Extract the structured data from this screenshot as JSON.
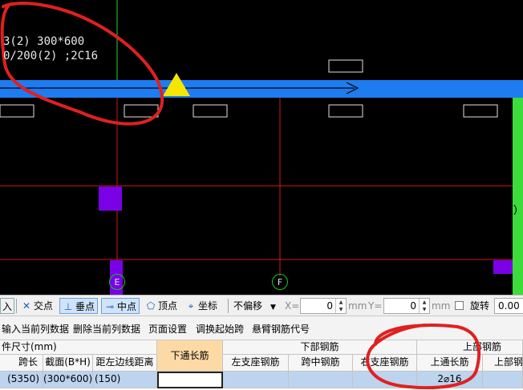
{
  "canvas": {
    "beam_label_line1": "3(2) 300*600",
    "beam_label_line2": "0/200(2) ;2C16",
    "axis_labels": [
      "E",
      "F"
    ],
    "colors": {
      "beam": "#1e7cf0",
      "support": "#f5e600",
      "column": "#7a00e6",
      "grid_line": "#d01818",
      "column_green": "#3cdc3c",
      "annotation": "#e02020"
    }
  },
  "snap_toolbar": {
    "insert_label": "入",
    "intersection_label": "交点",
    "perpendicular_label": "垂点",
    "midpoint_label": "中点",
    "vertex_label": "顶点",
    "coordinate_label": "坐标",
    "offset_select": "不偏移",
    "x_label": "X=",
    "x_value": "0",
    "x_unit": "mm",
    "y_label": "Y=",
    "y_value": "0",
    "y_unit": "mm",
    "rotate_label": "旋转",
    "rotate_value": "0.00",
    "icons": [
      "intersection-icon",
      "perpendicular-icon",
      "midpoint-icon",
      "vertex-icon",
      "coordinate-icon"
    ]
  },
  "operations": [
    "输入当前列数据",
    "删除当前列数据",
    "页面设置",
    "调换起始跨",
    "悬臂钢筋代号"
  ],
  "table": {
    "group_headers": {
      "size": "件尺寸(mm)",
      "bottom": "下部钢筋",
      "top": "上部钢筋"
    },
    "columns": [
      "跨长",
      "截面(B*H)",
      "距左边线距离",
      "下通长筋",
      "左支座钢筋",
      "跨中钢筋",
      "右支座钢筋",
      "上通长筋",
      "上部钢"
    ],
    "row": [
      "(5350)",
      "(300*600)",
      "(150)",
      "",
      "",
      "",
      "",
      "2⌀16",
      ""
    ]
  }
}
